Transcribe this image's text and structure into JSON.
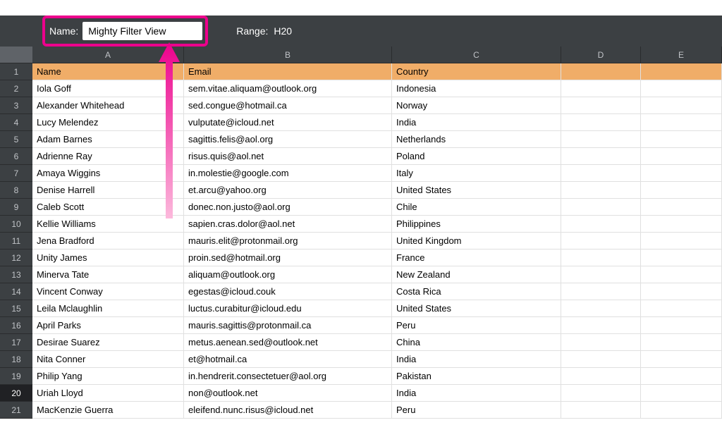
{
  "filterBar": {
    "nameLabel": "Name:",
    "nameValue": "Mighty Filter View",
    "rangeLabel": "Range:",
    "rangeValue": "H20"
  },
  "columns": [
    "A",
    "B",
    "C",
    "D",
    "E"
  ],
  "selectedRow": 20,
  "headerRow": {
    "name": "Name",
    "email": "Email",
    "country": "Country"
  },
  "rows": [
    {
      "name": "Iola Goff",
      "email": "sem.vitae.aliquam@outlook.org",
      "country": "Indonesia"
    },
    {
      "name": "Alexander Whitehead",
      "email": "sed.congue@hotmail.ca",
      "country": "Norway"
    },
    {
      "name": "Lucy Melendez",
      "email": "vulputate@icloud.net",
      "country": "India"
    },
    {
      "name": "Adam Barnes",
      "email": "sagittis.felis@aol.org",
      "country": "Netherlands"
    },
    {
      "name": "Adrienne Ray",
      "email": "risus.quis@aol.net",
      "country": "Poland"
    },
    {
      "name": "Amaya Wiggins",
      "email": "in.molestie@google.com",
      "country": "Italy"
    },
    {
      "name": "Denise Harrell",
      "email": "et.arcu@yahoo.org",
      "country": "United States"
    },
    {
      "name": "Caleb Scott",
      "email": "donec.non.justo@aol.org",
      "country": "Chile"
    },
    {
      "name": "Kellie Williams",
      "email": "sapien.cras.dolor@aol.net",
      "country": "Philippines"
    },
    {
      "name": "Jena Bradford",
      "email": "mauris.elit@protonmail.org",
      "country": "United Kingdom"
    },
    {
      "name": "Unity James",
      "email": "proin.sed@hotmail.org",
      "country": "France"
    },
    {
      "name": "Minerva Tate",
      "email": "aliquam@outlook.org",
      "country": "New Zealand"
    },
    {
      "name": "Vincent Conway",
      "email": "egestas@icloud.couk",
      "country": "Costa Rica"
    },
    {
      "name": "Leila Mclaughlin",
      "email": "luctus.curabitur@icloud.edu",
      "country": "United States"
    },
    {
      "name": "April Parks",
      "email": "mauris.sagittis@protonmail.ca",
      "country": "Peru"
    },
    {
      "name": "Desirae Suarez",
      "email": "metus.aenean.sed@outlook.net",
      "country": "China"
    },
    {
      "name": "Nita Conner",
      "email": "et@hotmail.ca",
      "country": "India"
    },
    {
      "name": "Philip Yang",
      "email": "in.hendrerit.consectetuer@aol.org",
      "country": "Pakistan"
    },
    {
      "name": "Uriah Lloyd",
      "email": "non@outlook.net",
      "country": "India"
    },
    {
      "name": "MacKenzie Guerra",
      "email": "eleifend.nunc.risus@icloud.net",
      "country": "Peru"
    }
  ]
}
